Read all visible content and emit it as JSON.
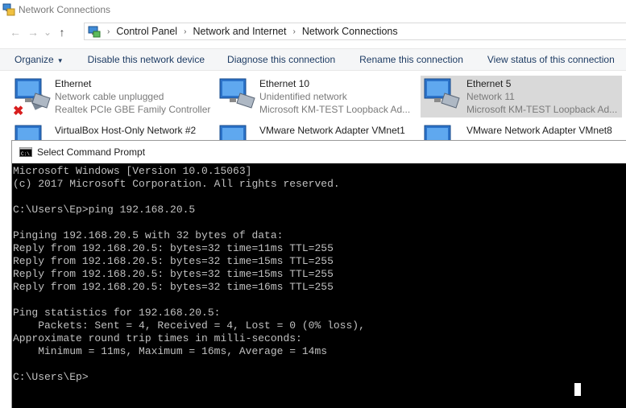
{
  "window": {
    "title": "Network Connections"
  },
  "address": {
    "crumbs": [
      "Control Panel",
      "Network and Internet",
      "Network Connections"
    ]
  },
  "commands": [
    {
      "label": "Organize"
    },
    {
      "label": "Disable this network device"
    },
    {
      "label": "Diagnose this connection"
    },
    {
      "label": "Rename this connection"
    },
    {
      "label": "View status of this connection"
    }
  ],
  "adapters": [
    {
      "name": "Ethernet",
      "status": "Network cable unplugged",
      "device": "Realtek PCIe GBE Family Controller",
      "error_badge": "✖"
    },
    {
      "name": "Ethernet 10",
      "status": "Unidentified network",
      "device": "Microsoft KM-TEST Loopback Ad..."
    },
    {
      "name": "Ethernet 5",
      "status": "Network  11",
      "device": "Microsoft KM-TEST Loopback Ad...",
      "selected": true
    },
    {
      "name": "VirtualBox Host-Only Network #2"
    },
    {
      "name": "VMware Network Adapter VMnet1"
    },
    {
      "name": "VMware Network Adapter VMnet8"
    }
  ],
  "cmd_window": {
    "title": "Select Command Prompt",
    "lines": [
      "Microsoft Windows [Version 10.0.15063]",
      "(c) 2017 Microsoft Corporation. All rights reserved.",
      "",
      "C:\\Users\\Ep>ping 192.168.20.5",
      "",
      "Pinging 192.168.20.5 with 32 bytes of data:",
      "Reply from 192.168.20.5: bytes=32 time=11ms TTL=255",
      "Reply from 192.168.20.5: bytes=32 time=15ms TTL=255",
      "Reply from 192.168.20.5: bytes=32 time=15ms TTL=255",
      "Reply from 192.168.20.5: bytes=32 time=16ms TTL=255",
      "",
      "Ping statistics for 192.168.20.5:",
      "    Packets: Sent = 4, Received = 4, Lost = 0 (0% loss),",
      "Approximate round trip times in milli-seconds:",
      "    Minimum = 11ms, Maximum = 16ms, Average = 14ms",
      "",
      "C:\\Users\\Ep>"
    ]
  },
  "icons": {
    "app": "network-connections-icon",
    "back": "←",
    "forward": "→",
    "recent": "⌄",
    "up": "↑",
    "crumb_sep": "›",
    "organize_caret": "▼"
  },
  "colors": {
    "command_text": "#1e3c64",
    "selection": "#d9d9d9",
    "console_bg": "#000000",
    "console_text": "#c0c0c0"
  }
}
